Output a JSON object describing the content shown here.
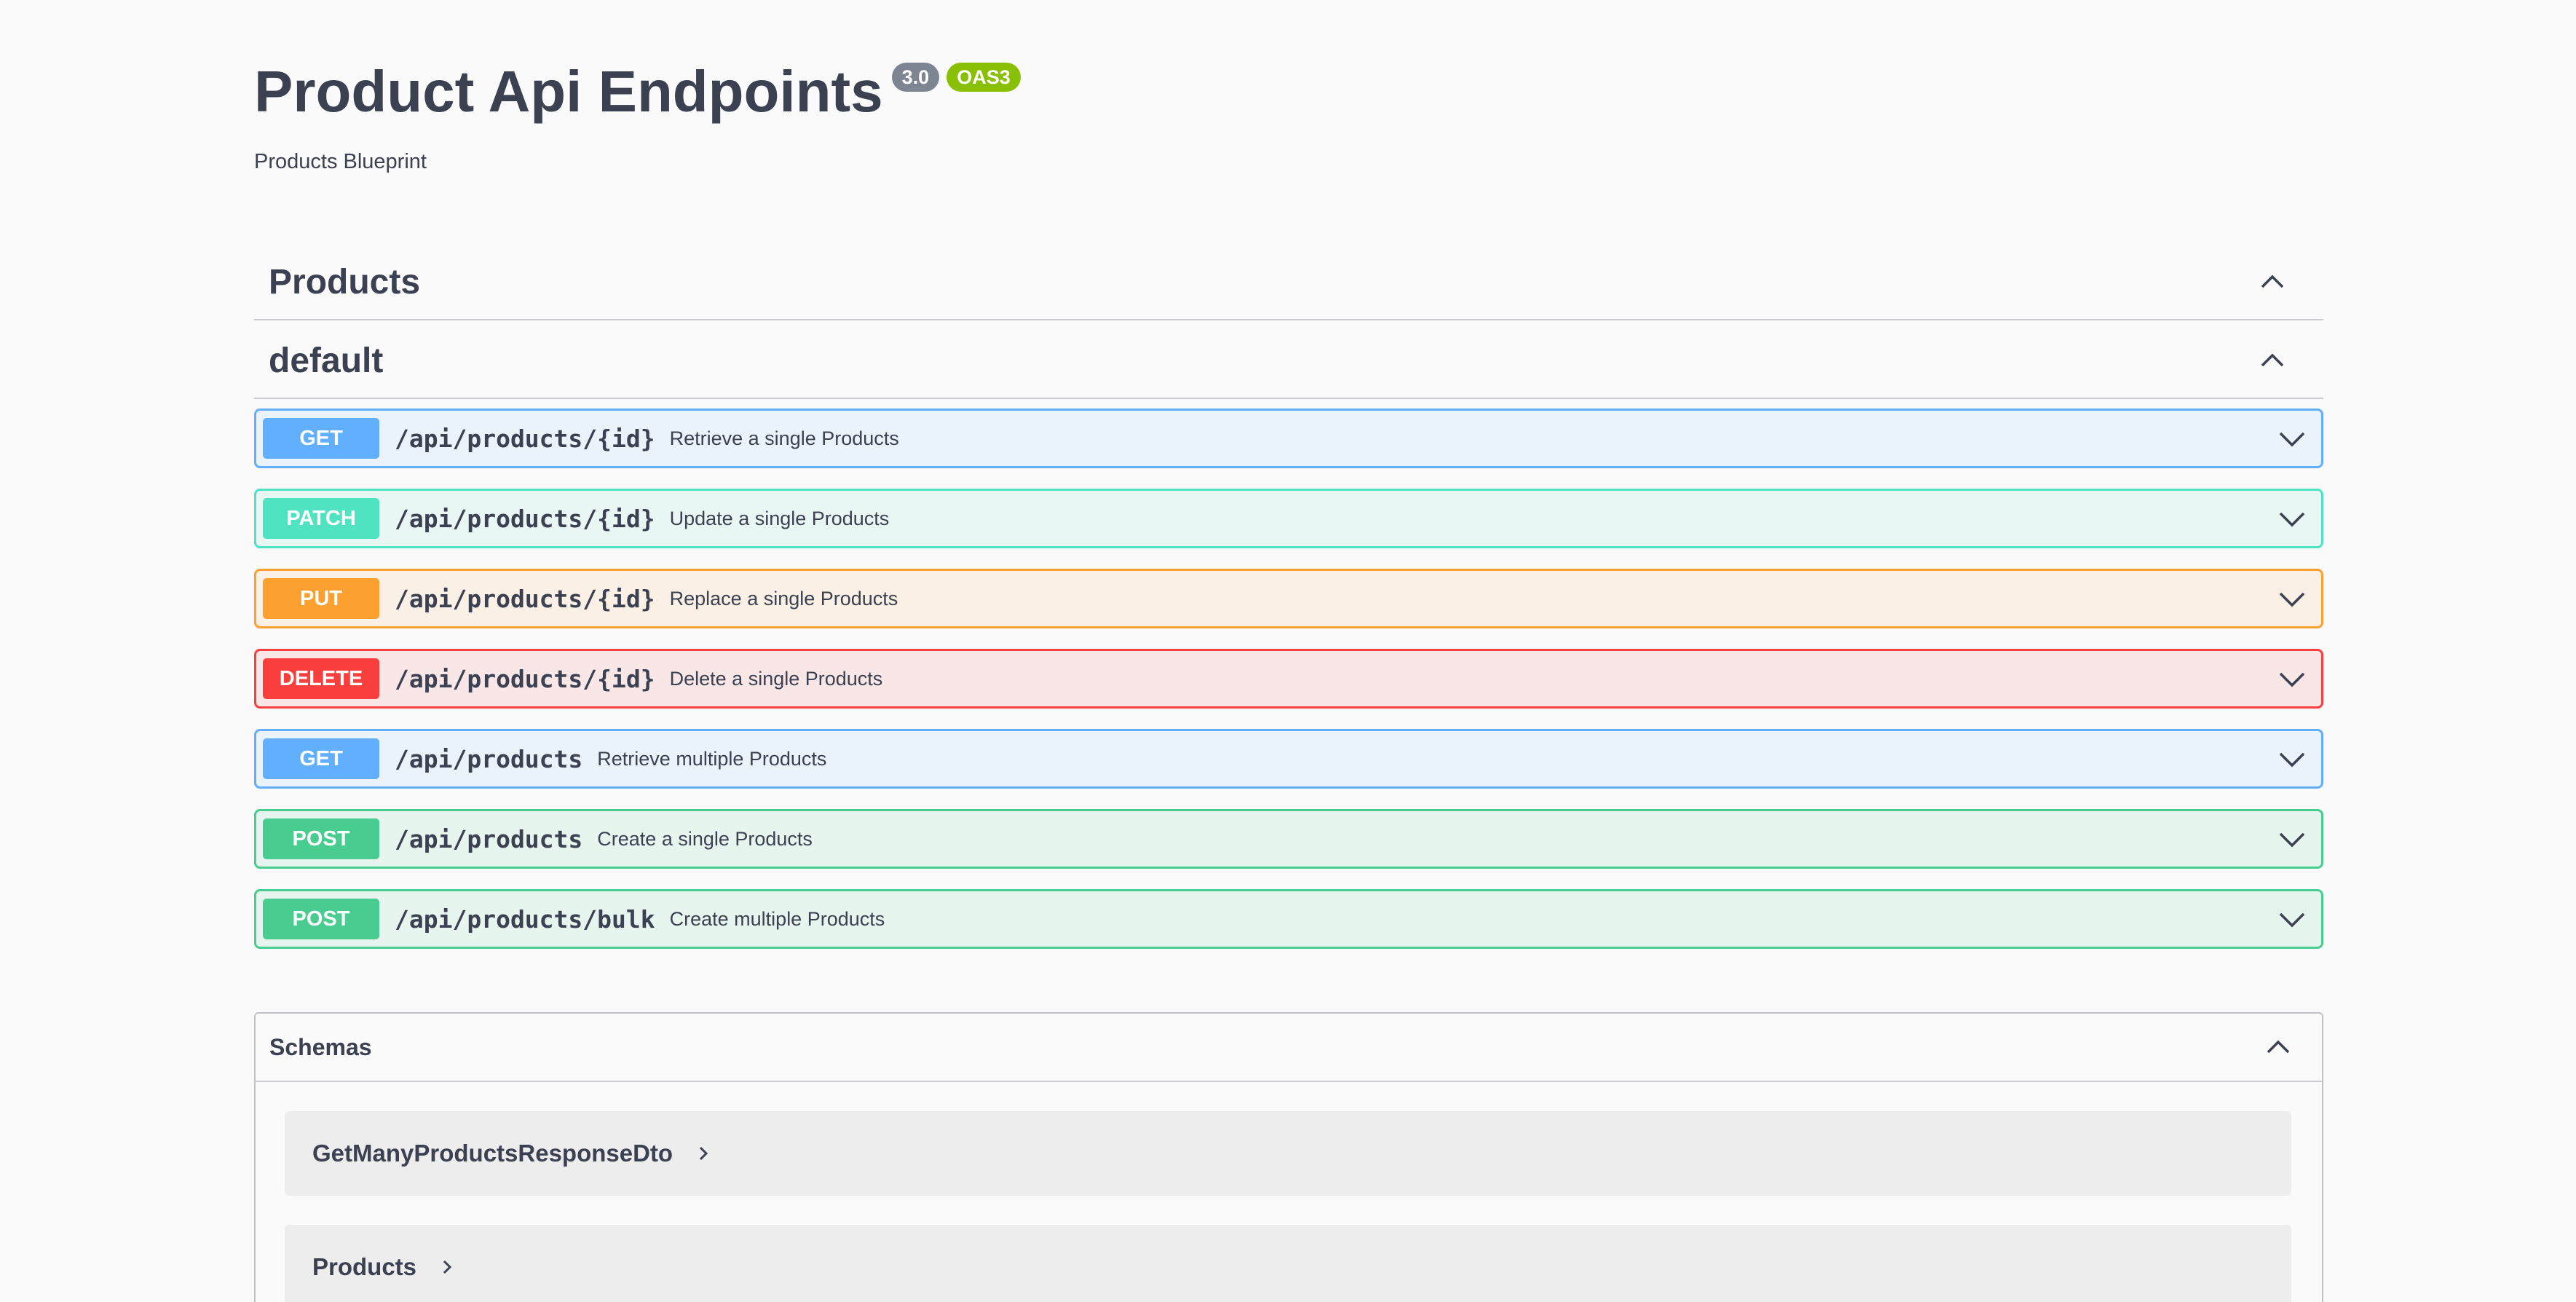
{
  "info": {
    "title": "Product Api Endpoints",
    "version": "3.0",
    "oas_badge": "OAS3",
    "description": "Products Blueprint"
  },
  "tags": [
    {
      "name": "Products"
    },
    {
      "name": "default"
    }
  ],
  "operations": [
    {
      "method": "GET",
      "path": "/api/products/{id}",
      "summary": "Retrieve a single Products",
      "color": "#61affe"
    },
    {
      "method": "PATCH",
      "path": "/api/products/{id}",
      "summary": "Update a single Products",
      "color": "#50e3c2"
    },
    {
      "method": "PUT",
      "path": "/api/products/{id}",
      "summary": "Replace a single Products",
      "color": "#fca130"
    },
    {
      "method": "DELETE",
      "path": "/api/products/{id}",
      "summary": "Delete a single Products",
      "color": "#f93e3e"
    },
    {
      "method": "GET",
      "path": "/api/products",
      "summary": "Retrieve multiple Products",
      "color": "#61affe"
    },
    {
      "method": "POST",
      "path": "/api/products",
      "summary": "Create a single Products",
      "color": "#49cc90"
    },
    {
      "method": "POST",
      "path": "/api/products/bulk",
      "summary": "Create multiple Products",
      "color": "#49cc90"
    }
  ],
  "schemas": {
    "title": "Schemas",
    "models": [
      {
        "name": "GetManyProductsResponseDto"
      },
      {
        "name": "Products"
      }
    ]
  },
  "icons": {
    "collapse": "chevron-up-icon",
    "expand": "chevron-down-icon",
    "model_expand": "chevron-right-icon"
  }
}
